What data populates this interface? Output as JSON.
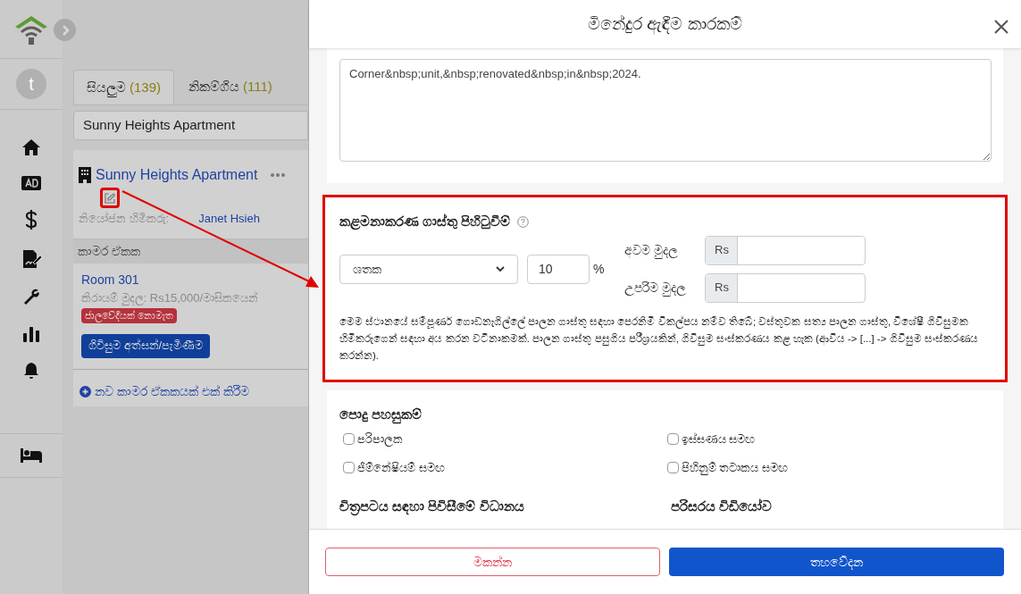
{
  "sidebar": {
    "avatar": "t"
  },
  "tabs": [
    {
      "label": "සියලුම",
      "count": "(139)",
      "selected": true
    },
    {
      "label": "නිකම්ගිය",
      "count": "(111)",
      "selected": false
    }
  ],
  "search": {
    "value": "Sunny Heights Apartment"
  },
  "property": {
    "name": "Sunny Heights Apartment",
    "manager_label": "නියෝජන හිමිකරු:",
    "manager": "Janet Hsieh",
    "units_heading": "කාමර ඒකක",
    "units": [
      {
        "name": "Room 301",
        "rent": "කිරායම් මුදල: Rs15,000/මාසිකයෙන්",
        "badge": "ජාලවේදියක් නොමැත",
        "button": "ගිවිසුම අත්සන්/පැමිණීම"
      }
    ],
    "add_unit": "නව කාමර ඒකකයක් එක් කිරීම"
  },
  "modal": {
    "title": "මිනේදුර ඇඳීම කාරකම්",
    "notes": "Corner&nbsp;unit,&nbsp;renovated&nbsp;in&nbsp;2024.",
    "fee": {
      "title": "කළමනාකරණ ගාස්තු පිහිටුවීම්",
      "type": "ශතක",
      "percent": "10",
      "percent_sign": "%",
      "min_label": "අවම මුදල",
      "min_currency": "Rs",
      "max_label": "උපරිම මුදල",
      "max_currency": "Rs",
      "description": "මෙම ස්ථානයේ සම්පූර්ණ ගොඩනැගිල්ලේ පාලන ගාස්තු සඳහා පෙරනිමි විකල්පය නම්ව තිබේ; වස්තුවක සත්‍ය පාලන ගාස්තු, විශේෂී ගිවිසුමක හිමිකරුගෙන් සඳහා අය කරන වටිනාකමක්. පාලන ගාස්තු පසුගිය පරීශ්‍රයකින්, ගිවිසුම සංස්කරණය කළ හැක (ආවිය -> [...] -> ගිවිසුම සංස්කරණය කරන්න)."
    },
    "amenities": {
      "title": "පොදු පහසුකම්",
      "items": [
        {
          "label": "පරිපාලක",
          "checked": false
        },
        {
          "label": "ඉස්සණය සමඟ",
          "checked": false
        },
        {
          "label": "ජිම්නේෂියම් සමඟ",
          "checked": false
        },
        {
          "label": "පිහිනුම් තටාකය සමඟ",
          "checked": false
        }
      ]
    },
    "headings": [
      "චිත්‍රපටය සඳහා පිවිසීමේ විධානය",
      "පරිසරය විඩියෝව"
    ],
    "cancel": "මකන්න",
    "submit": "තහවේදන"
  }
}
